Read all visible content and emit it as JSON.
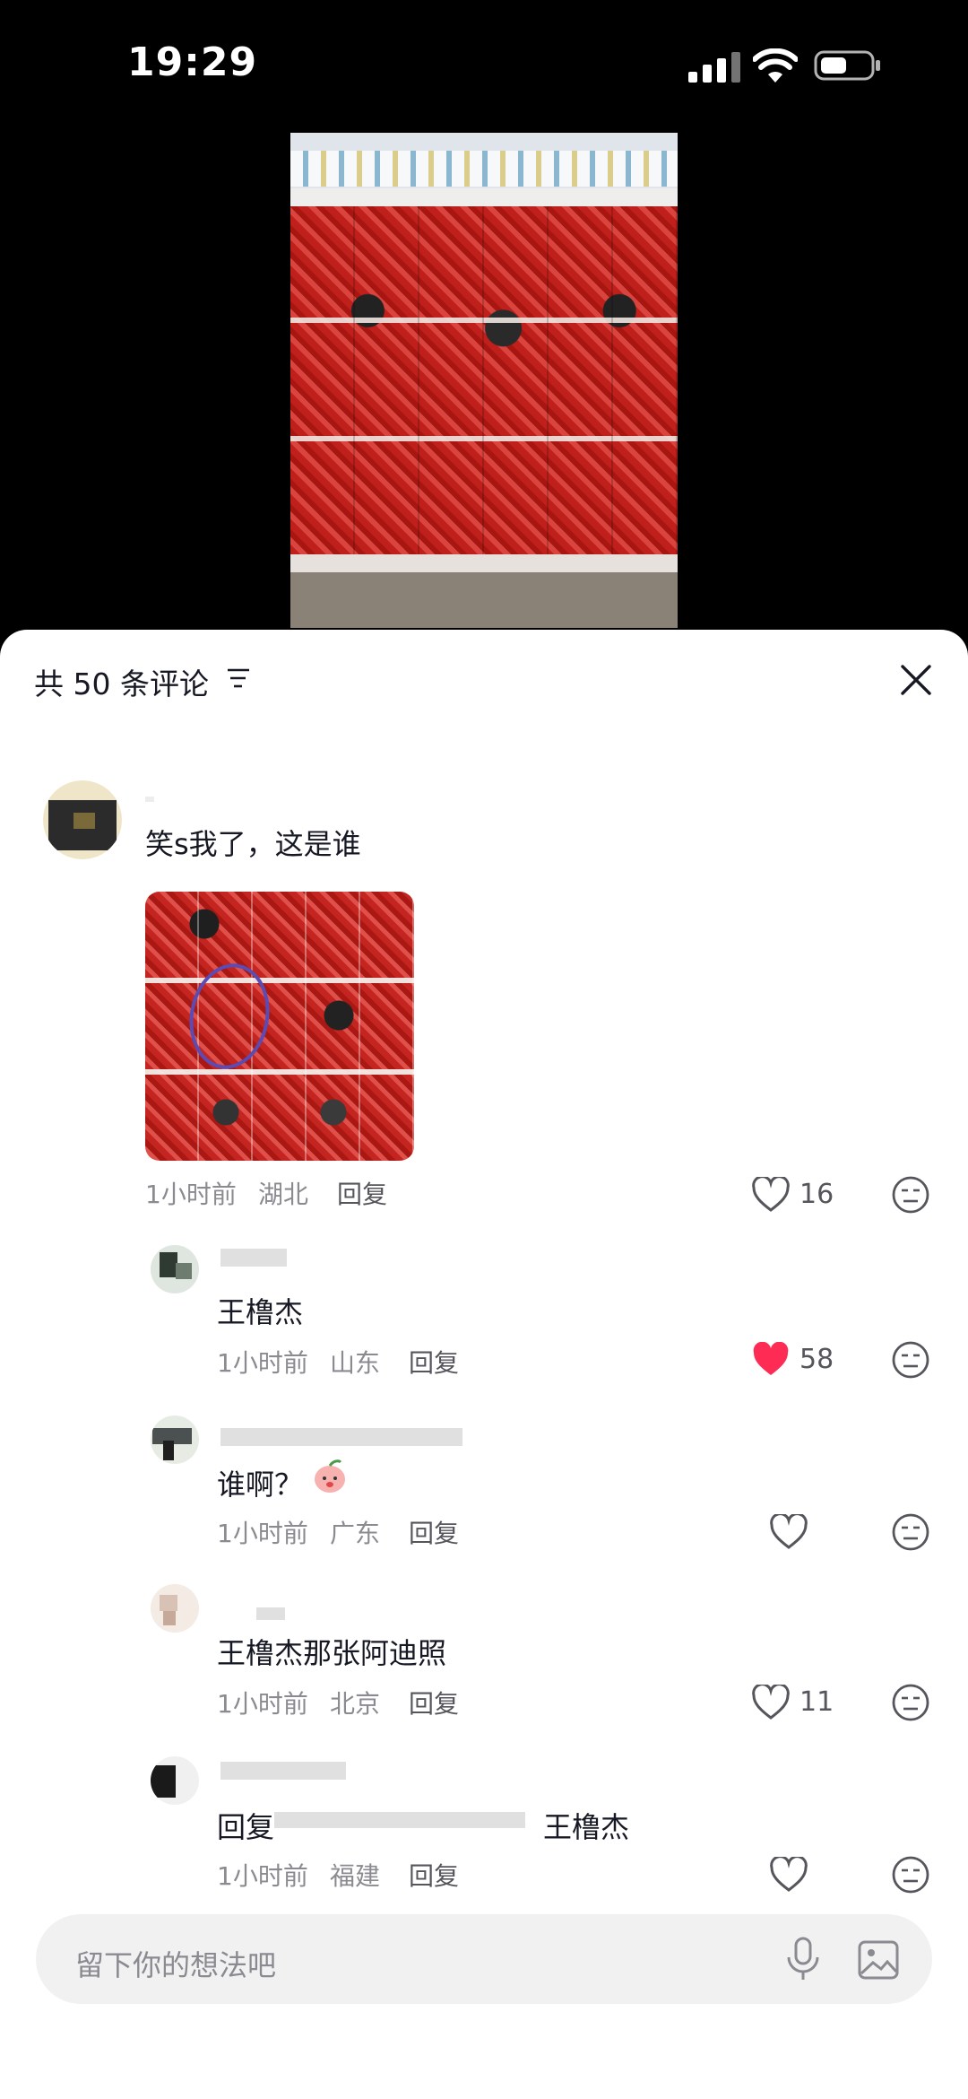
{
  "status_bar": {
    "time": "19:29"
  },
  "comments_panel": {
    "title": "共 50 条评论",
    "input_placeholder": "留下你的想法吧"
  },
  "comments": [
    {
      "username": "",
      "text": "笑s我了，这是谁",
      "time": "1小时前",
      "location": "湖北",
      "reply_label": "回复",
      "likes": "16",
      "liked": false,
      "has_image": true
    },
    {
      "username": "",
      "text": "王橹杰",
      "time": "1小时前",
      "location": "山东",
      "reply_label": "回复",
      "likes": "58",
      "liked": true
    },
    {
      "username": "",
      "text": "谁啊？",
      "time": "1小时前",
      "location": "广东",
      "reply_label": "回复",
      "likes": "",
      "liked": false
    },
    {
      "username": "",
      "text": "王橹杰那张阿迪照",
      "time": "1小时前",
      "location": "北京",
      "reply_label": "回复",
      "likes": "11",
      "liked": false
    },
    {
      "username": "",
      "text_prefix": "回复",
      "text_suffix": "王橹杰",
      "time": "1小时前",
      "location": "福建",
      "reply_label": "回复",
      "likes": "",
      "liked": false
    }
  ],
  "colors": {
    "liked": "#fe2c55",
    "text": "#161823",
    "secondary": "#8a8b91"
  },
  "icons": [
    "signal-icon",
    "wifi-icon",
    "battery-icon",
    "sort-icon",
    "close-icon",
    "heart-icon",
    "emoji-icon",
    "mic-icon",
    "image-icon"
  ]
}
